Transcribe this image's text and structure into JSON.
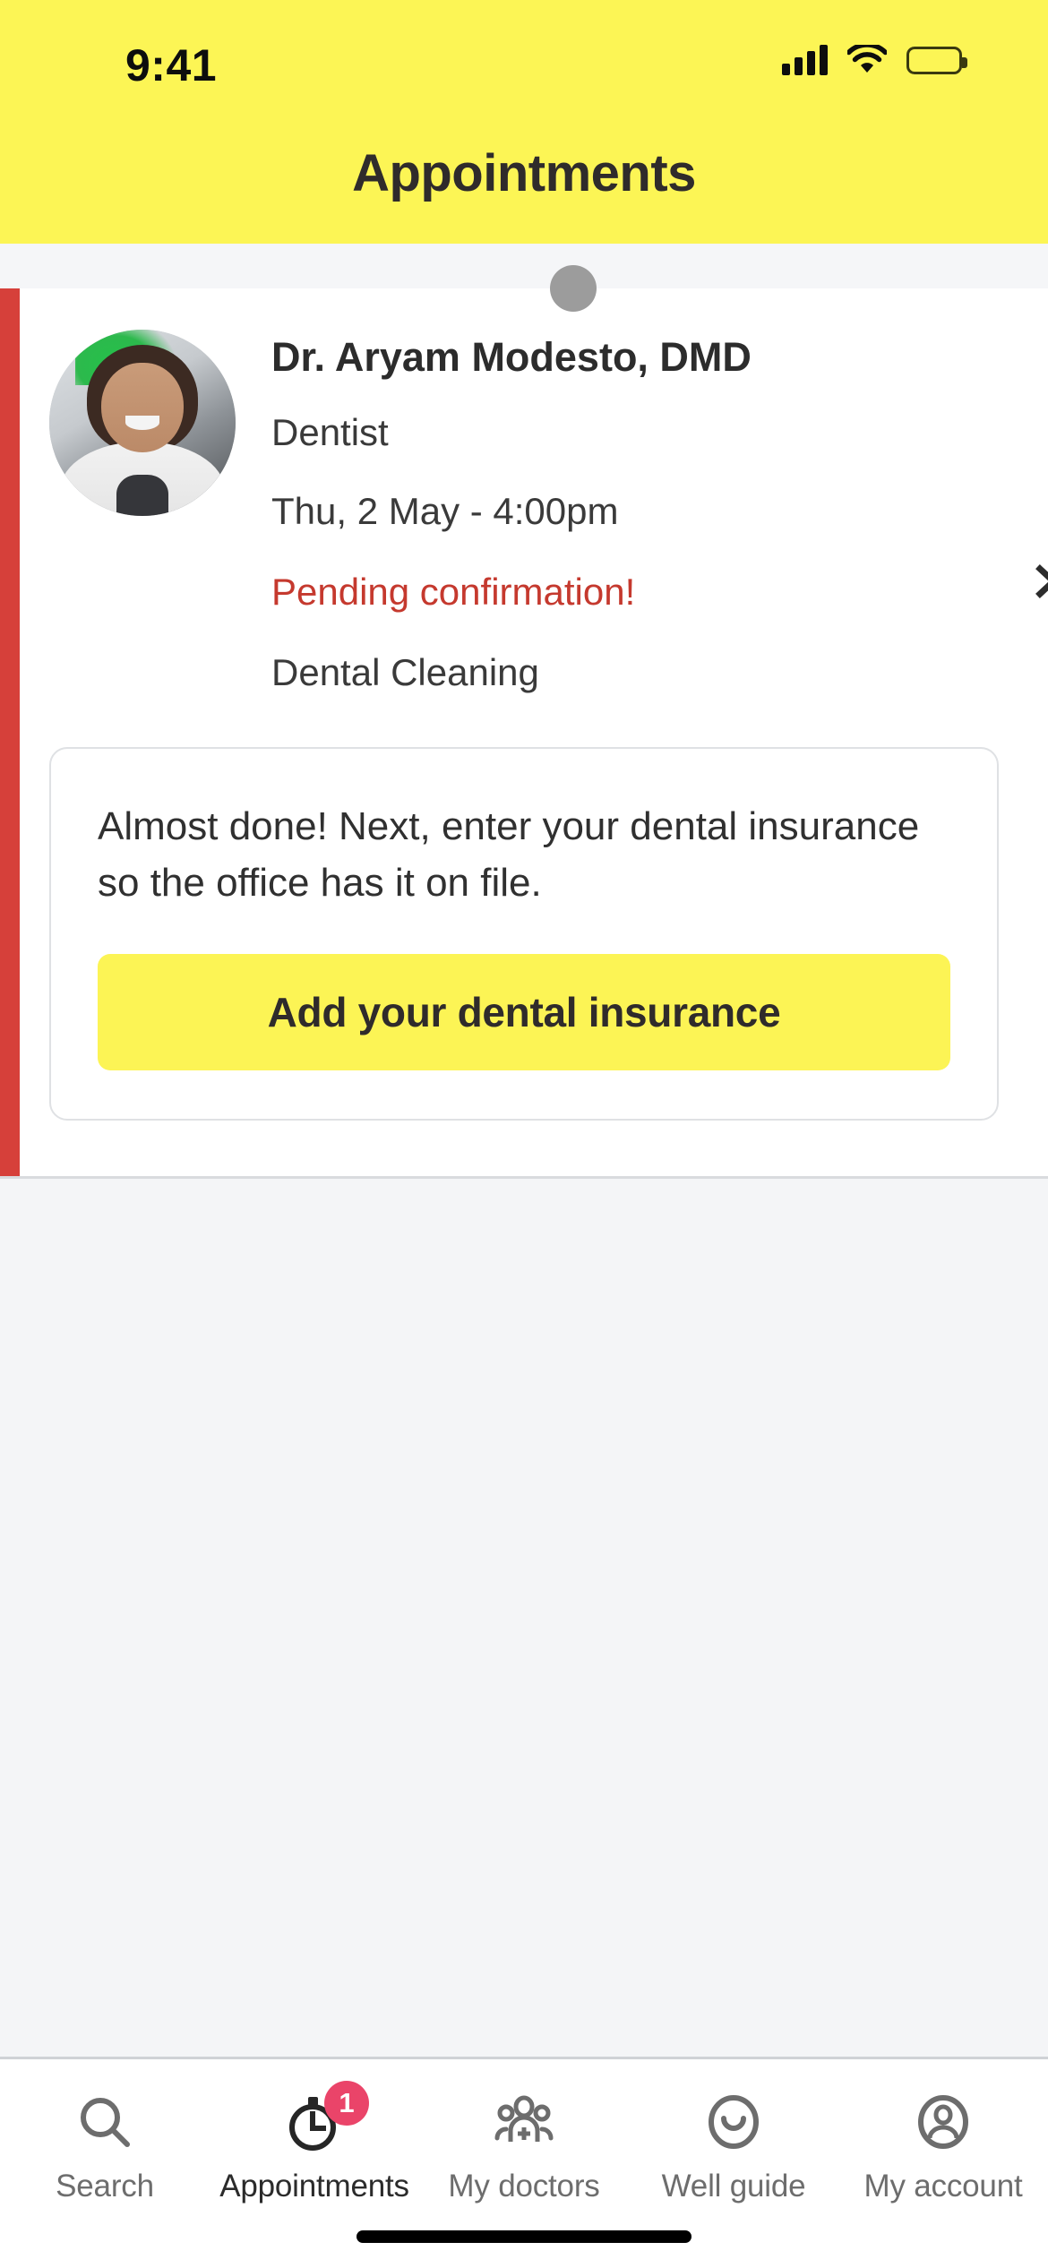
{
  "status_bar": {
    "time": "9:41",
    "signal_icon": "cellular-signal-icon",
    "wifi_icon": "wifi-icon",
    "battery_icon": "battery-full-icon"
  },
  "header": {
    "title": "Appointments",
    "background_color": "#fcf555",
    "title_color": "#2f2b2b"
  },
  "appointment_card": {
    "accent_color": "#d6403a",
    "handle_dot": "drag-handle-dot",
    "avatar_alt": "doctor-profile-photo",
    "doctor_name": "Dr. Aryam Modesto, DMD",
    "specialty": "Dentist",
    "datetime": "Thu, 2 May - 4:00pm",
    "status": "Pending confirmation!",
    "status_color": "#c5392e",
    "reason": "Dental Cleaning",
    "chevron_icon": "chevron-right-icon"
  },
  "insurance_prompt": {
    "message": "Almost done! Next, enter your dental insurance so the office has it on file.",
    "cta_label": "Add your dental insurance",
    "cta_color": "#fcf455"
  },
  "tab_bar": {
    "items": [
      {
        "label": "Search",
        "icon": "search-icon",
        "active": false,
        "badge": null
      },
      {
        "label": "Appointments",
        "icon": "clock-icon",
        "active": true,
        "badge": "1"
      },
      {
        "label": "My doctors",
        "icon": "doctors-group-icon",
        "active": false,
        "badge": null
      },
      {
        "label": "Well guide",
        "icon": "smiley-face-icon",
        "active": false,
        "badge": null
      },
      {
        "label": "My account",
        "icon": "user-circle-icon",
        "active": false,
        "badge": null
      }
    ],
    "badge_color": "#ea4469",
    "inactive_color": "#6d6d6d",
    "active_color": "#2b2b2b"
  },
  "home_indicator": "home-indicator-bar"
}
